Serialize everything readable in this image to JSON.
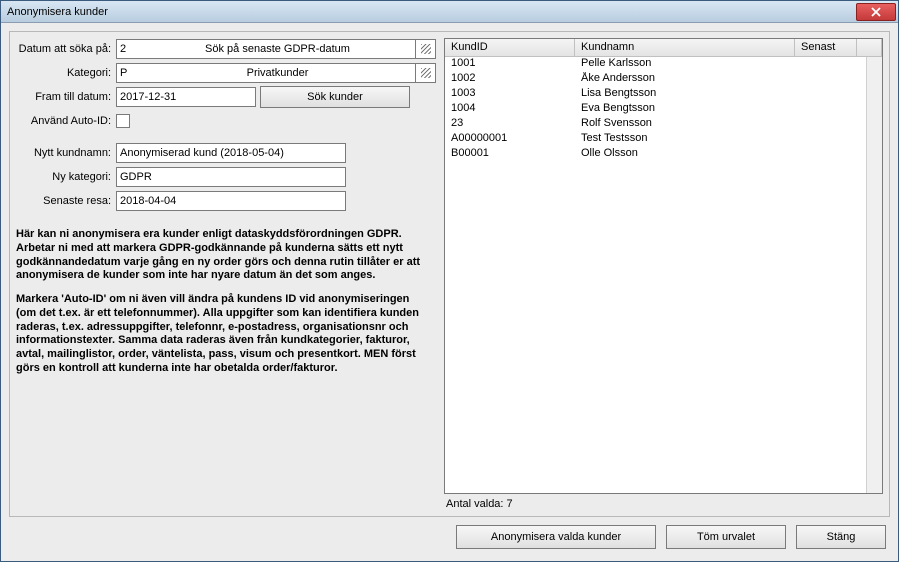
{
  "window": {
    "title": "Anonymisera kunder"
  },
  "form": {
    "datum_att_soka_label": "Datum att söka på:",
    "datum_att_soka_code": "2",
    "datum_att_soka_text": "Sök på senaste GDPR-datum",
    "kategori_label": "Kategori:",
    "kategori_code": "P",
    "kategori_text": "Privatkunder",
    "fram_till_datum_label": "Fram till datum:",
    "fram_till_datum_value": "2017-12-31",
    "sok_kunder_label": "Sök kunder",
    "anvand_auto_id_label": "Använd Auto-ID:",
    "nytt_kundnamn_label": "Nytt kundnamn:",
    "nytt_kundnamn_value": "Anonymiserad kund (2018-05-04)",
    "ny_kategori_label": "Ny kategori:",
    "ny_kategori_value": "GDPR",
    "senaste_resa_label": "Senaste resa:",
    "senaste_resa_value": "2018-04-04"
  },
  "info": {
    "p1": "Här kan ni anonymisera era kunder enligt dataskyddsförordningen GDPR. Arbetar ni med att markera GDPR-godkännande på kunderna sätts ett nytt godkännandedatum varje gång en ny order görs och denna rutin tillåter er att anonymisera de kunder som inte har nyare datum än det som anges.",
    "p2": "Markera 'Auto-ID' om ni även vill ändra på kundens ID vid anonymiseringen (om det t.ex. är ett telefonnummer). Alla uppgifter som kan identifiera kunden raderas, t.ex. adressuppgifter, telefonnr, e-postadress, organisationsnr och informationstexter. Samma data raderas även från kundkategorier, fakturor, avtal, mailinglistor, order, väntelista, pass, visum och presentkort. MEN först görs en kontroll att kunderna inte har obetalda order/fakturor."
  },
  "table": {
    "headers": {
      "kundid": "KundID",
      "kundnamn": "Kundnamn",
      "senast": "Senast"
    },
    "rows": [
      {
        "id": "1001",
        "namn": "Pelle Karlsson",
        "senast": ""
      },
      {
        "id": "1002",
        "namn": "Åke Andersson",
        "senast": ""
      },
      {
        "id": "1003",
        "namn": "Lisa Bengtsson",
        "senast": ""
      },
      {
        "id": "1004",
        "namn": "Eva Bengtsson",
        "senast": ""
      },
      {
        "id": "23",
        "namn": "Rolf Svensson",
        "senast": ""
      },
      {
        "id": "A00000001",
        "namn": "Test Testsson",
        "senast": ""
      },
      {
        "id": "B00001",
        "namn": "Olle Olsson",
        "senast": ""
      }
    ],
    "count_label": "Antal valda: 7"
  },
  "buttons": {
    "anonymisera": "Anonymisera valda kunder",
    "tom_urvalet": "Töm urvalet",
    "stang": "Stäng"
  }
}
